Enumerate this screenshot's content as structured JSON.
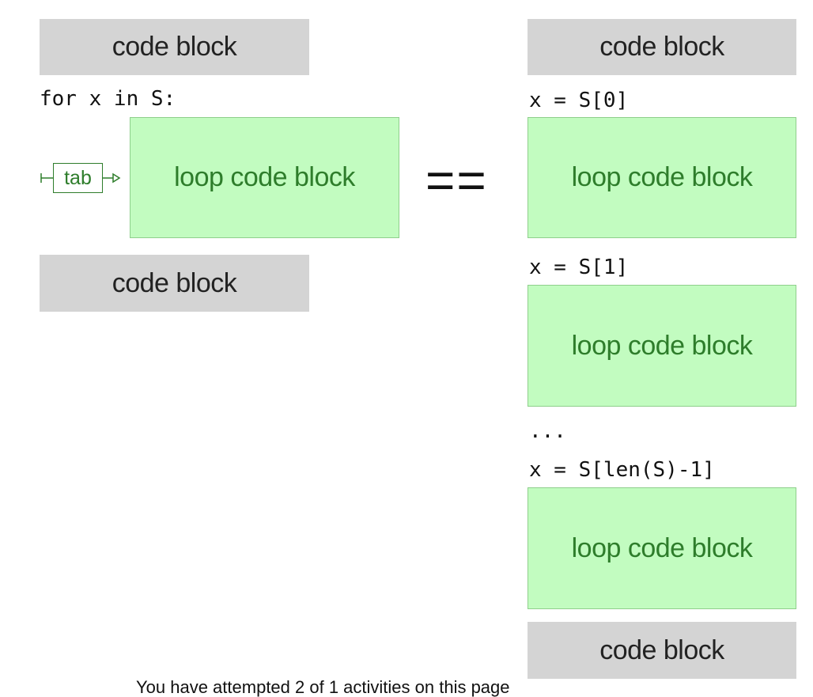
{
  "left": {
    "top_block": "code block",
    "loop_header": "for x in S:",
    "tab_label": "tab",
    "loop_block": "loop code block",
    "bottom_block": "code block"
  },
  "equals": "==",
  "right": {
    "top_block": "code block",
    "assign_0": "x = S[0]",
    "loop_block_0": "loop code block",
    "assign_1": "x = S[1]",
    "loop_block_1": "loop code block",
    "ellipsis": "...",
    "assign_last": "x = S[len(S)-1]",
    "loop_block_last": "loop code block",
    "bottom_block": "code block"
  },
  "footer_text": "You have attempted 2 of 1 activities on this page",
  "colors": {
    "gray_block": "#d4d4d4",
    "green_block": "#c2fcc0",
    "green_text": "#2e7d2b"
  }
}
